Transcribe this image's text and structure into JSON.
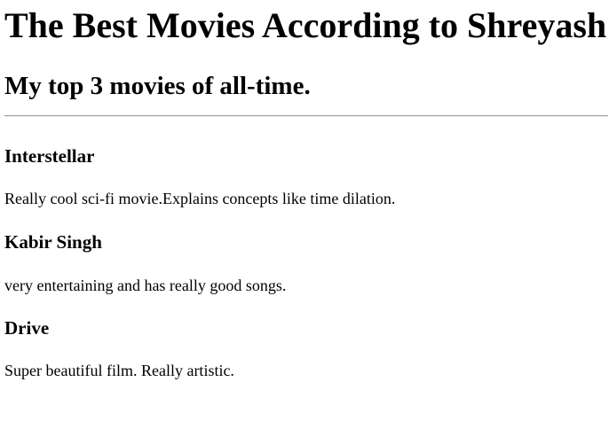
{
  "page": {
    "title": "The Best Movies According to Shreyash",
    "subtitle": "My top 3 movies of all-time."
  },
  "movies": [
    {
      "title": "Interstellar",
      "description": "Really cool sci-fi movie.Explains concepts like time dilation."
    },
    {
      "title": "Kabir Singh",
      "description": "very entertaining and has really good songs."
    },
    {
      "title": "Drive",
      "description": "Super beautiful film. Really artistic."
    }
  ]
}
